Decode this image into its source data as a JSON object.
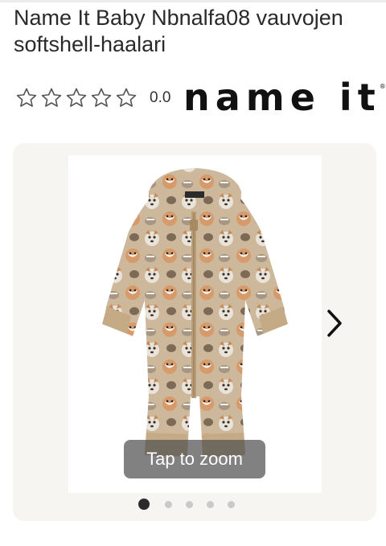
{
  "product": {
    "title": "Name It Baby Nbnalfa08 vauvojen softshell-haalari",
    "rating": {
      "value": "0.0",
      "stars_total": 5,
      "stars_filled": 0
    },
    "brand": {
      "name": "name it",
      "mark": "®"
    }
  },
  "gallery": {
    "zoom_hint": "Tap to zoom",
    "next_icon": "chevron-right-icon",
    "image_count": 5,
    "active_index": 0
  },
  "colors": {
    "gallery_bg": "#f7f5f1",
    "suit_base": "#cdb89c",
    "zipper": "#b99d76",
    "active_dot": "#2b2b2b",
    "inactive_dot": "#c9c9c9"
  }
}
